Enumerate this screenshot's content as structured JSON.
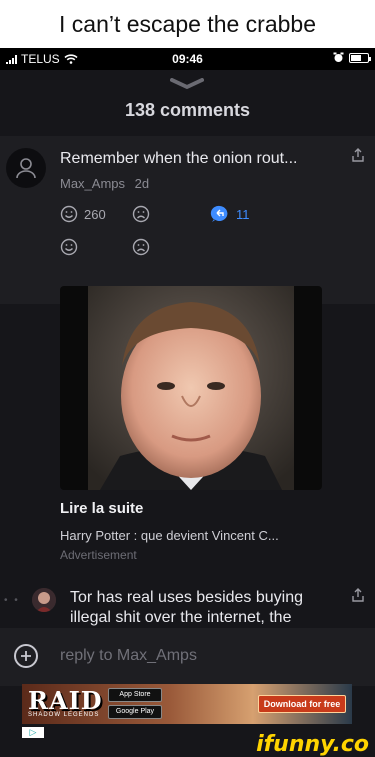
{
  "meme_caption": "I can’t escape the crabbe",
  "status": {
    "carrier": "TELUS",
    "time": "09:46"
  },
  "sheet": {
    "title": "138 comments"
  },
  "comment": {
    "text": "Remember when the onion rout...",
    "user": "Max_Amps",
    "time": "2d",
    "smile_count": "260",
    "reply_count": "11"
  },
  "ad": {
    "title": "Lire la suite",
    "description": "Harry Potter : que devient Vincent C...",
    "label": "Advertisement"
  },
  "comment2": {
    "dots": "• •",
    "text": "Tor has real uses besides buying illegal shit over the internet, the"
  },
  "reply_bar": {
    "placeholder": "reply to Max_Amps"
  },
  "banner": {
    "brand": "RAID",
    "tagline": "SHADOW LEGENDS",
    "app_store": "App Store",
    "google_play": "Google Play",
    "cta": "Download for free"
  },
  "watermark": "ifunny.co",
  "colors": {
    "accent": "#3e8cff",
    "watermark": "#ffd400"
  }
}
